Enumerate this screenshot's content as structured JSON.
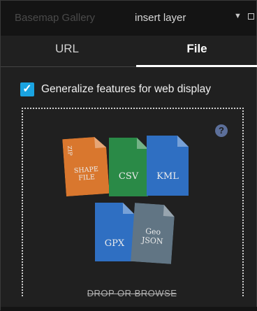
{
  "header": {
    "gallery_label": "Basemap Gallery",
    "insert_label": "insert layer",
    "dropdown_glyph": "▼",
    "maximize_icon": "square-window-icon"
  },
  "tabs": [
    {
      "label": "URL",
      "selected": false
    },
    {
      "label": "File",
      "selected": true
    }
  ],
  "options": {
    "generalize_label": "Generalize features for web display",
    "generalize_checked": true,
    "checkmark": "✓"
  },
  "dropzone": {
    "help_glyph": "?",
    "file_types": [
      {
        "label": "SHAPE\nFILE",
        "tab_label": "ZIP",
        "color": "#d9772e"
      },
      {
        "label": "CSV",
        "color": "#2a8a47"
      },
      {
        "label": "KML",
        "color": "#2f6fc2"
      },
      {
        "label": "GPX",
        "color": "#2f6fc2"
      },
      {
        "label": "Geo\nJSON",
        "color": "#617584"
      }
    ],
    "drop_label": "DROP OR BROWSE"
  },
  "colors": {
    "accent": "#1aa3e0",
    "panel_bg": "#202020",
    "header_bg": "#141414"
  }
}
